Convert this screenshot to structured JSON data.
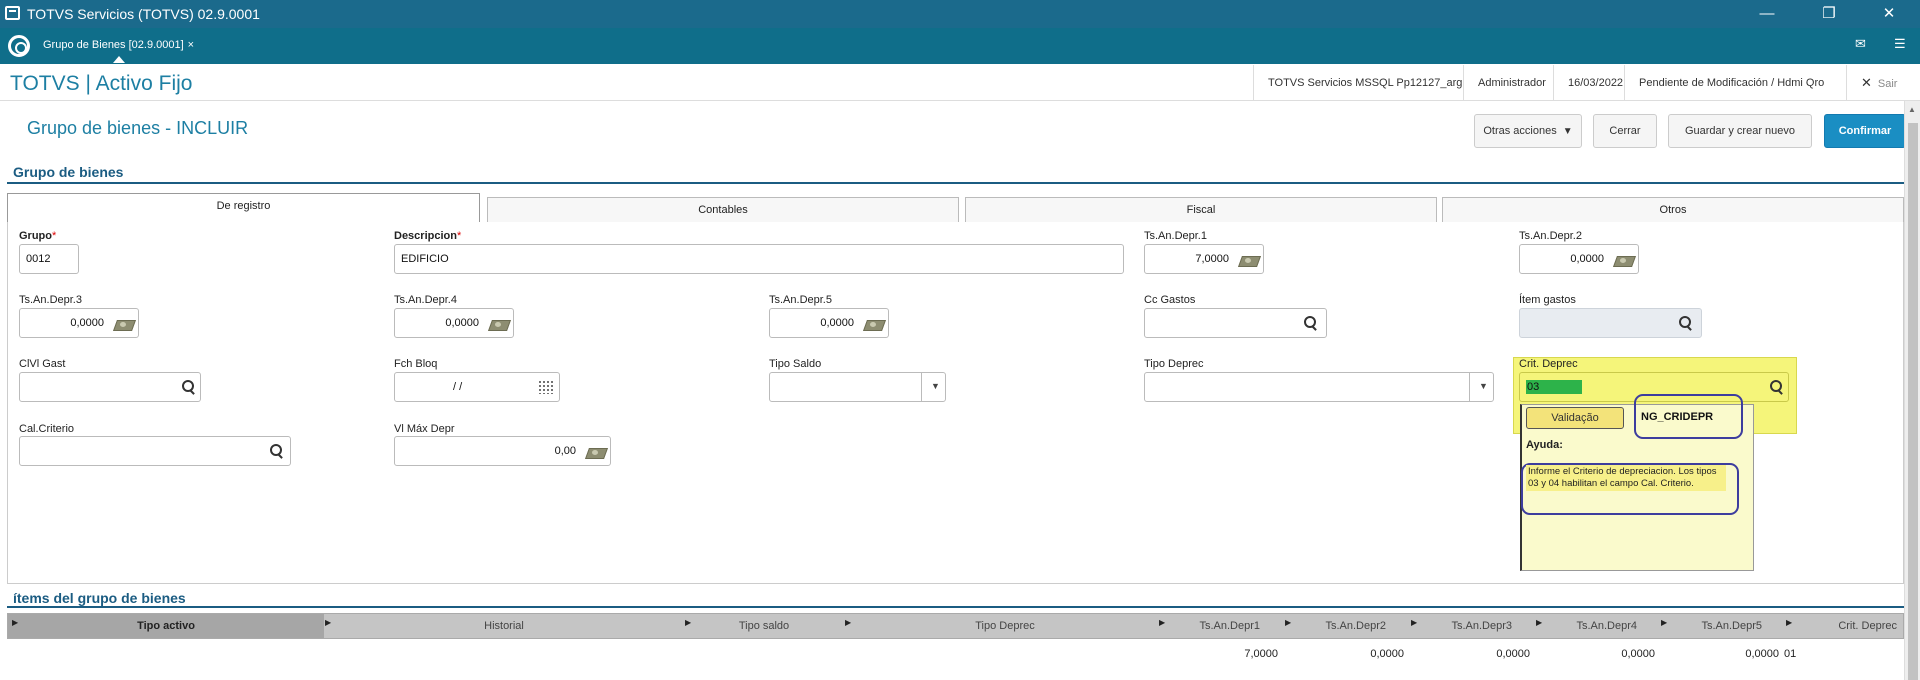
{
  "window": {
    "title": "TOTVS Servicios (TOTVS) 02.9.0001",
    "icon": "app-window-icon",
    "controls": [
      "—",
      "❐",
      "✕"
    ]
  },
  "tabstrip": {
    "tab_label": "Grupo de Bienes [02.9.0001]",
    "tab_close": "×",
    "mail_icon": "✉",
    "menu_icon": "☰"
  },
  "header": {
    "brand": "TOTVS | Activo Fijo",
    "environment": "TOTVS Servicios MSSQL Pp12127_arg",
    "user": "Administrador",
    "date": "16/03/2022",
    "branch": "Pendiente de Modificación / Hdmi Qro",
    "exit_icon": "✕",
    "exit_label": "Sair"
  },
  "form": {
    "title": "Grupo de bienes - INCLUIR",
    "actions": {
      "otras": "Otras acciones",
      "cerrar": "Cerrar",
      "guardar": "Guardar y crear nuevo",
      "confirmar": "Confirmar"
    },
    "section_title": "Grupo de bienes",
    "tabs": [
      "De registro",
      "Contables",
      "Fiscal",
      "Otros"
    ]
  },
  "fields": {
    "grupo": {
      "label": "Grupo",
      "required": "*",
      "value": "0012"
    },
    "descripcion": {
      "label": "Descripcion",
      "required": "*",
      "value": "EDIFICIO"
    },
    "ts1": {
      "label": "Ts.An.Depr.1",
      "value": "7,0000"
    },
    "ts2": {
      "label": "Ts.An.Depr.2",
      "value": "0,0000"
    },
    "ts3": {
      "label": "Ts.An.Depr.3",
      "value": "0,0000"
    },
    "ts4": {
      "label": "Ts.An.Depr.4",
      "value": "0,0000"
    },
    "ts5": {
      "label": "Ts.An.Depr.5",
      "value": "0,0000"
    },
    "cc_gastos": {
      "label": "Cc Gastos",
      "value": ""
    },
    "item_gastos": {
      "label": "Ítem gastos",
      "value": ""
    },
    "clvl_gast": {
      "label": "ClVl Gast",
      "value": ""
    },
    "fch_bloq": {
      "label": "Fch Bloq",
      "value": " /  / "
    },
    "tipo_saldo": {
      "label": "Tipo Saldo",
      "value": ""
    },
    "tipo_deprec": {
      "label": "Tipo Deprec",
      "value": ""
    },
    "crit_deprec": {
      "label": "Crit. Deprec",
      "value": "03"
    },
    "cal_criterio": {
      "label": "Cal.Criterio",
      "value": ""
    },
    "vl_max_depr": {
      "label": "Vl Máx Depr",
      "value": "0,00"
    }
  },
  "help_popup": {
    "validation_button": "Validação",
    "field_id": "NG_CRIDEPR",
    "title": "Ayuda:",
    "text": "Informe el Criterio de depreciacion. Los tipos 03 y 04 habilitan el campo Cal. Criterio."
  },
  "items": {
    "section_title": "ítems del grupo de bienes",
    "columns": [
      "Tipo activo",
      "Historial",
      "Tipo saldo",
      "Tipo Deprec",
      "Ts.An.Depr1",
      "Ts.An.Depr2",
      "Ts.An.Depr3",
      "Ts.An.Depr4",
      "Ts.An.Depr5",
      "Crit. Deprec"
    ],
    "rows": [
      [
        "",
        "",
        "",
        "",
        "7,0000",
        "0,0000",
        "0,0000",
        "0,0000",
        "0,0000",
        "01"
      ]
    ]
  },
  "colors": {
    "title_bar": "#1b6a8c",
    "brand": "#1d7fa3",
    "primary_button": "#1a8ec3",
    "help_yellow": "#f5f57a",
    "highlight_green": "#2db34a"
  }
}
